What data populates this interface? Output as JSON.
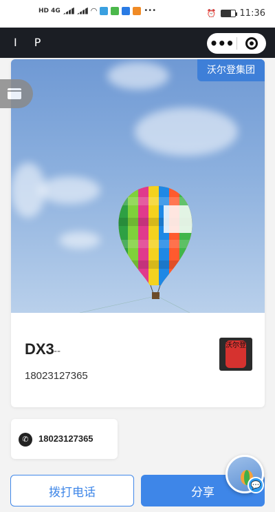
{
  "status_bar": {
    "network_left": "HD 4G",
    "time": "11:36"
  },
  "nav": {
    "title": "I P"
  },
  "card": {
    "corp_tag": "沃尔登集团",
    "name": "DX3",
    "name_suffix": "--",
    "phone": "18023127365",
    "logo_text": "沃尔登"
  },
  "contact_chip": {
    "phone": "18023127365"
  },
  "actions": {
    "call_label": "拨打电话",
    "share_label": "分享"
  },
  "icons": {
    "float": "card-stack-icon",
    "phone": "phone-icon",
    "chat": "chat-icon",
    "menu": "more-dots-icon",
    "close": "target-circle-icon"
  },
  "colors": {
    "accent": "#3e86e8",
    "navbar": "#1b1e24",
    "tag": "#3e7fd8"
  }
}
